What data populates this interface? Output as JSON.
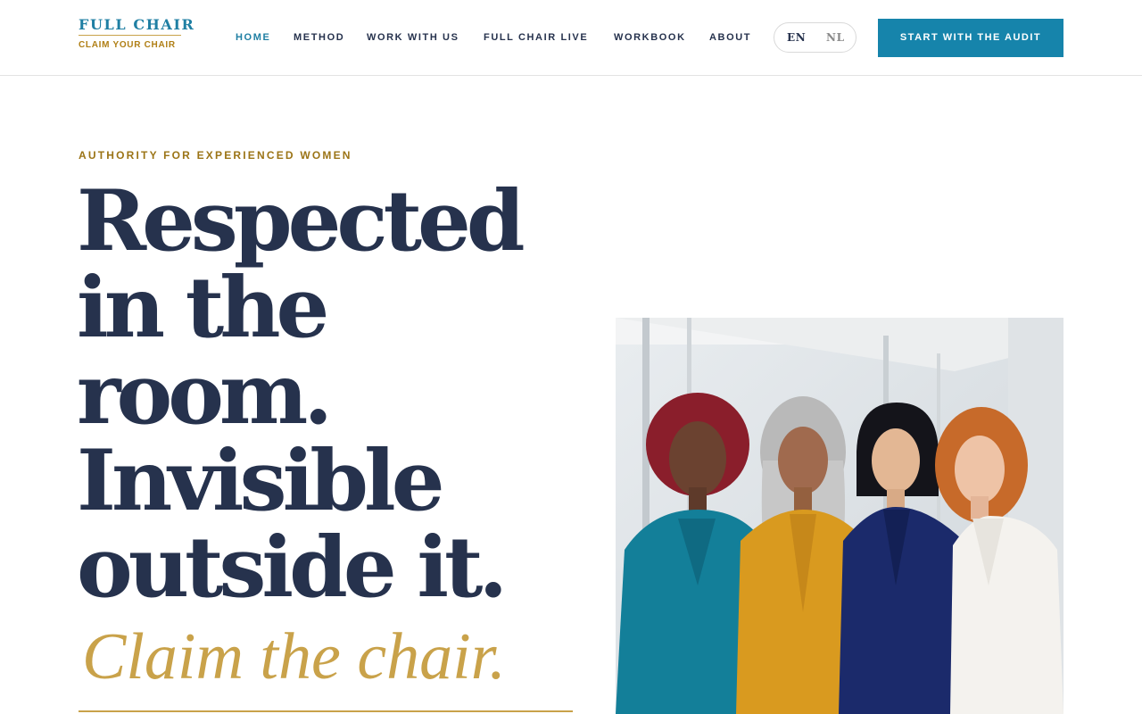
{
  "brand": {
    "name": "FULL CHAIR",
    "tagline": "CLAIM YOUR CHAIR"
  },
  "nav": {
    "items": [
      {
        "label": "HOME",
        "active": true
      },
      {
        "label": "METHOD",
        "active": false
      },
      {
        "label": "WORK WITH US",
        "active": false
      },
      {
        "label": "FULL CHAIR LIVE",
        "active": false
      },
      {
        "label": "WORKBOOK",
        "active": false
      },
      {
        "label": "ABOUT",
        "active": false
      }
    ]
  },
  "language": {
    "options": [
      "EN",
      "NL"
    ],
    "selected": "EN"
  },
  "cta": {
    "label": "START WITH THE AUDIT"
  },
  "hero": {
    "eyebrow": "AUTHORITY FOR EXPERIENCED WOMEN",
    "headline_lines": [
      "Respected",
      "in the",
      "room.",
      "Invisible",
      "outside it."
    ],
    "tagline": "Claim the chair.",
    "image_alt": "Four experienced women in colorful suits standing together"
  },
  "colors": {
    "accent": "#1684ab",
    "navy": "#26324d",
    "gold": "#c9a24a",
    "gold_dark": "#9b7416"
  }
}
